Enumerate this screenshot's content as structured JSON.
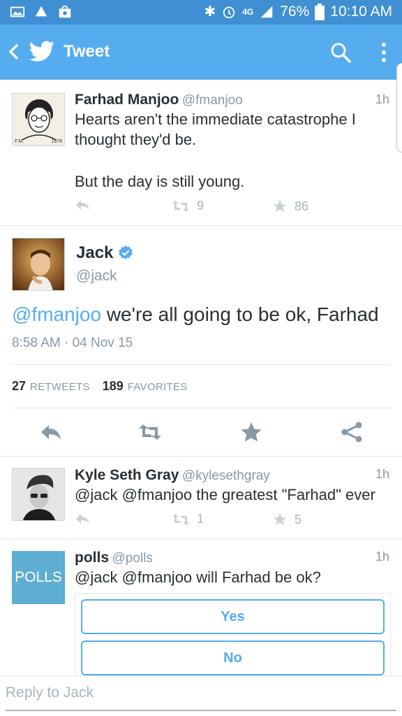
{
  "status_bar": {
    "battery": "76%",
    "time": "10:10 AM",
    "network": "4G",
    "icons": [
      "gallery-icon",
      "drive-icon",
      "store-icon",
      "bluetooth-icon",
      "alarm-icon",
      "signal-icon",
      "battery-icon"
    ]
  },
  "app_bar": {
    "title": "Tweet",
    "color": "#55acee"
  },
  "tweets": [
    {
      "name": "Farhad Manjoo",
      "handle": "@fmanjoo",
      "time": "1h",
      "text_line1": "Hearts aren't the immediate catastrophe I",
      "text_line2": "thought they'd be.",
      "text_line3": "But the day is still young.",
      "retweets": "9",
      "likes": "86",
      "avatar_caption_left": "F.M.",
      "avatar_caption_right": "1978"
    }
  ],
  "main_tweet": {
    "name": "Jack",
    "handle": "@jack",
    "mention": "@fmanjoo",
    "text": " we're all going to be ok, Farhad",
    "date": "8:58 AM · 04 Nov 15",
    "retweet_count": "27",
    "retweet_label": "RETWEETS",
    "favorite_count": "189",
    "favorite_label": "FAVORITES",
    "verified": true
  },
  "replies": [
    {
      "name": "Kyle Seth Gray",
      "handle": "@kylesethgray",
      "time": "1h",
      "text": "@jack @fmanjoo the greatest \"Farhad\" ever",
      "retweets": "1",
      "likes": "5"
    },
    {
      "name": "polls",
      "handle": "@polls",
      "time": "1h",
      "text": "@jack @fmanjoo will Farhad be ok?",
      "avatar_text": "POLLS",
      "options": [
        "Yes",
        "No"
      ]
    }
  ],
  "reply_bar": {
    "placeholder": "Reply to Jack"
  },
  "colors": {
    "accent": "#55acee",
    "status_bar": "#3f8fd2",
    "muted": "#8899a6"
  }
}
